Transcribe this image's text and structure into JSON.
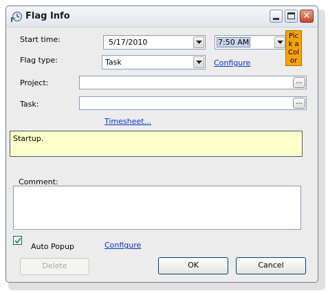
{
  "window": {
    "title": "Flag Info",
    "minimize": "minimize",
    "maximize": "maximize",
    "close": "✕"
  },
  "form": {
    "start_time_label": "Start time:",
    "date_value": "5/17/2010",
    "time_value": "7:50 AM",
    "flag_type_label": "Flag type:",
    "flag_type_value": "Task",
    "flag_type_configure": "Configure",
    "pick_color_label": "Pick a Color",
    "pick_color_lines": [
      "Pic",
      "k a",
      "Col",
      "or"
    ],
    "pick_color_bg": "#f7a10b",
    "project_label": "Project:",
    "project_value": "",
    "project_browse": "...",
    "task_label": "Task:",
    "task_value": "",
    "task_browse": "...",
    "timesheet_link": "Timesheet...",
    "note_text": "Startup.",
    "note_bg": "#ffffcc",
    "comment_label": "Comment:",
    "comment_value": "",
    "auto_popup_label": "Auto Popup",
    "auto_popup_checked": true,
    "bottom_configure": "Configure"
  },
  "buttons": {
    "delete": "Delete",
    "ok": "OK",
    "cancel": "Cancel"
  },
  "icons": {
    "app": "clock-flag-icon",
    "dropdown": "chevron-down-icon",
    "check": "checkmark-icon"
  }
}
